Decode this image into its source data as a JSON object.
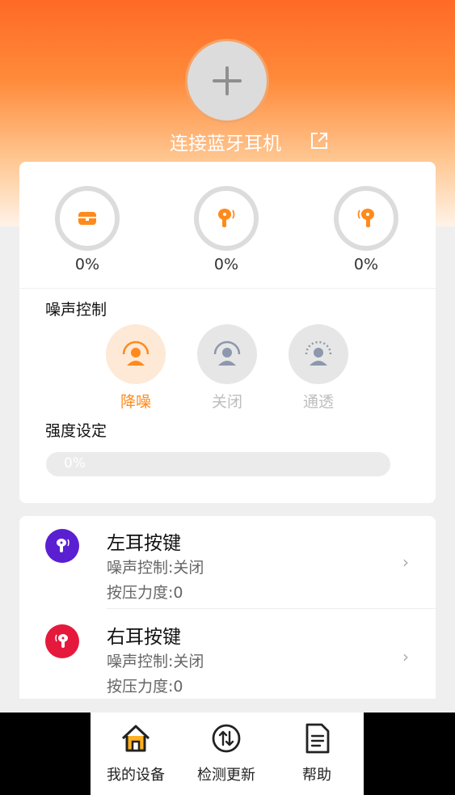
{
  "header": {
    "add_icon": "plus-icon",
    "title": "连接蓝牙耳机",
    "link_icon": "external-link-icon"
  },
  "battery": [
    {
      "icon": "case-icon",
      "value": "0%"
    },
    {
      "icon": "left-earbud-icon",
      "value": "0%"
    },
    {
      "icon": "right-earbud-icon",
      "value": "0%"
    }
  ],
  "noise_control": {
    "label": "噪声控制",
    "modes": [
      {
        "label": "降噪",
        "selected": true
      },
      {
        "label": "关闭",
        "selected": false
      },
      {
        "label": "通透",
        "selected": false
      }
    ]
  },
  "intensity": {
    "label": "强度设定",
    "value_text": "0%",
    "value": 0
  },
  "ear_buttons": [
    {
      "title": "左耳按键",
      "noise_line": "噪声控制:关闭",
      "pressure_line": "按压力度:0",
      "color": "#5a1fd1"
    },
    {
      "title": "右耳按键",
      "noise_line": "噪声控制:关闭",
      "pressure_line": "按压力度:0",
      "color": "#e5193c"
    }
  ],
  "tabs": [
    {
      "label": "我的设备",
      "icon": "home-icon"
    },
    {
      "label": "检测更新",
      "icon": "update-icon"
    },
    {
      "label": "帮助",
      "icon": "document-icon"
    }
  ],
  "colors": {
    "accent": "#ff8a1c",
    "inactive": "#bdbdbd"
  }
}
